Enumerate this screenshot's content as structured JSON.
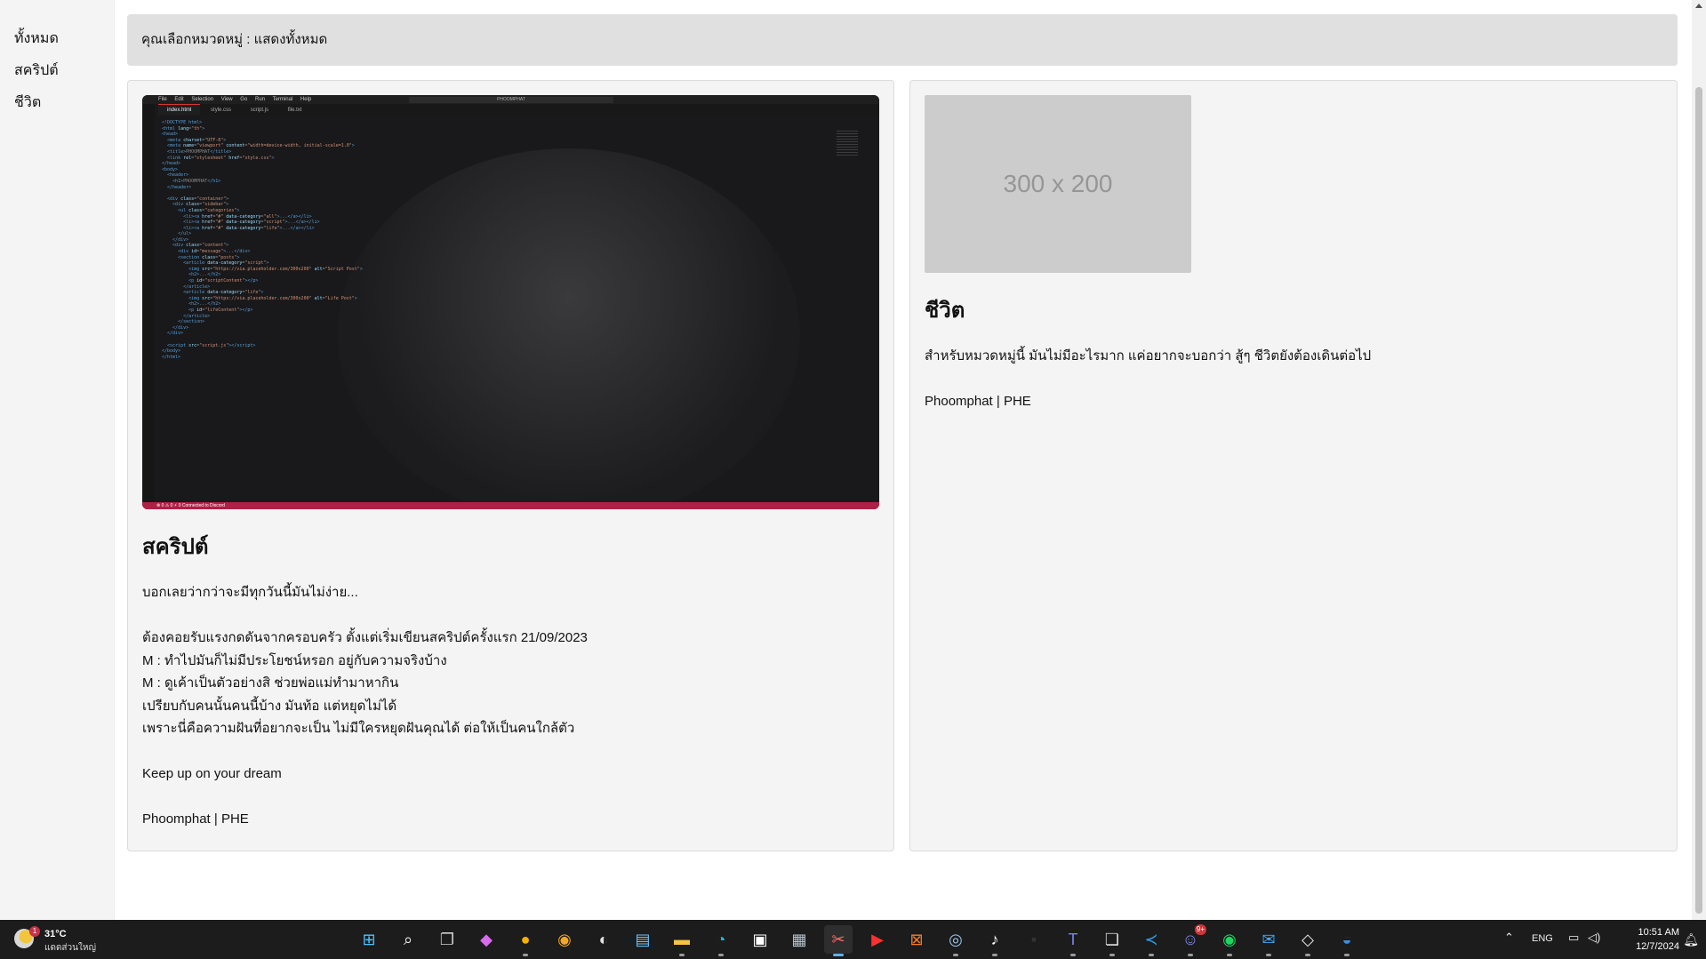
{
  "sidebar": {
    "categories": [
      "ทั้งหมด",
      "สคริปต์",
      "ชีวิต"
    ]
  },
  "message": "คุณเลือกหมวดหมู่ : แสดงทั้งหมด",
  "posts": [
    {
      "category": "script",
      "title": "สคริปต์",
      "lines": [
        "บอกเลยว่ากว่าจะมีทุกวันนี้มันไม่ง่าย...",
        "",
        "ต้องคอยรับแรงกดดันจากครอบครัว ตั้งแต่เริ่มเขียนสคริปต์ครั้งแรก 21/09/2023",
        "M : ทำไปมันก็ไม่มีประโยชน์หรอก อยู่กับความจริงบ้าง",
        "M : ดูเค้าเป็นตัวอย่างสิ ช่วยพ่อแม่ทำมาหากิน",
        "เปรียบกับคนนั้นคนนี้บ้าง มันท้อ แต่หยุดไม่ได้",
        "เพราะนี่คือความฝันที่อยากจะเป็น ไม่มีใครหยุดฝันคุณได้ ต่อให้เป็นคนใกล้ตัว",
        "",
        "Keep up on your dream",
        "",
        "Phoomphat | PHE"
      ],
      "image": {
        "menu": [
          "File",
          "Edit",
          "Selection",
          "View",
          "Go",
          "Run",
          "Terminal",
          "Help"
        ],
        "search": "PHOOMPHAT",
        "tabs": [
          "index.html",
          "style.css",
          "script.js",
          "file.txt"
        ],
        "status": "⊗ 0 ⚠ 0   ⚡ 0   Connected to Discord"
      }
    },
    {
      "category": "life",
      "title": "ชีวิต",
      "placeholder": "300 x 200",
      "lines": [
        "สำหรับหมวดหมู่นี้ มันไม่มีอะไรมาก แค่อยากจะบอกว่า สู้ๆ ชีวิตยังต้องเดินต่อไป",
        "",
        "Phoomphat | PHE"
      ]
    }
  ],
  "taskbar": {
    "weather": {
      "temp": "31°C",
      "desc": "แดดส่วนใหญ่",
      "badge": "1"
    },
    "apps": [
      {
        "name": "windows-start",
        "glyph": "⊞",
        "color": "#4cc2ff"
      },
      {
        "name": "search",
        "glyph": "⌕",
        "color": "#ffffff"
      },
      {
        "name": "task-view",
        "glyph": "❐",
        "color": "#cfcfcf"
      },
      {
        "name": "copilot",
        "glyph": "◆",
        "color": "#d86bf0"
      },
      {
        "name": "chrome",
        "glyph": "●",
        "color": "#f4b400"
      },
      {
        "name": "chrome-canary",
        "glyph": "◉",
        "color": "#f6a623"
      },
      {
        "name": "obs",
        "glyph": "◐",
        "color": "#e0e0e0"
      },
      {
        "name": "notepad",
        "glyph": "▤",
        "color": "#6fc3ff"
      },
      {
        "name": "file-explorer",
        "glyph": "▬",
        "color": "#f5c542"
      },
      {
        "name": "edge",
        "glyph": "◔",
        "color": "#2fb3e0"
      },
      {
        "name": "microsoft-store",
        "glyph": "▣",
        "color": "#ffffff"
      },
      {
        "name": "calculator",
        "glyph": "▦",
        "color": "#b8c4cf"
      },
      {
        "name": "snipping-tool",
        "glyph": "✂",
        "color": "#ff6b6b"
      },
      {
        "name": "youtube",
        "glyph": "▶",
        "color": "#ff3030"
      },
      {
        "name": "xampp",
        "glyph": "⊠",
        "color": "#fb7a24"
      },
      {
        "name": "steam",
        "glyph": "◎",
        "color": "#9bc8f2"
      },
      {
        "name": "tiktok",
        "glyph": "♪",
        "color": "#ffffff"
      },
      {
        "name": "blank-app",
        "glyph": "▪",
        "color": "#333333"
      },
      {
        "name": "teams",
        "glyph": "T",
        "color": "#7b83eb"
      },
      {
        "name": "duplicate-windows",
        "glyph": "❏",
        "color": "#dddddd"
      },
      {
        "name": "vscode",
        "glyph": "≺",
        "color": "#2aa3f0"
      },
      {
        "name": "discord",
        "glyph": "☺",
        "color": "#7b8bf0",
        "badge": "9+"
      },
      {
        "name": "spotify",
        "glyph": "◉",
        "color": "#1ed760"
      },
      {
        "name": "mail",
        "glyph": "✉",
        "color": "#3fa9f5"
      },
      {
        "name": "roblox",
        "glyph": "◇",
        "color": "#e6e6e6"
      },
      {
        "name": "edge-dev",
        "glyph": "◒",
        "color": "#3a90e8"
      }
    ],
    "lang": "ENG",
    "time": "10:51 AM",
    "date": "12/7/2024"
  }
}
